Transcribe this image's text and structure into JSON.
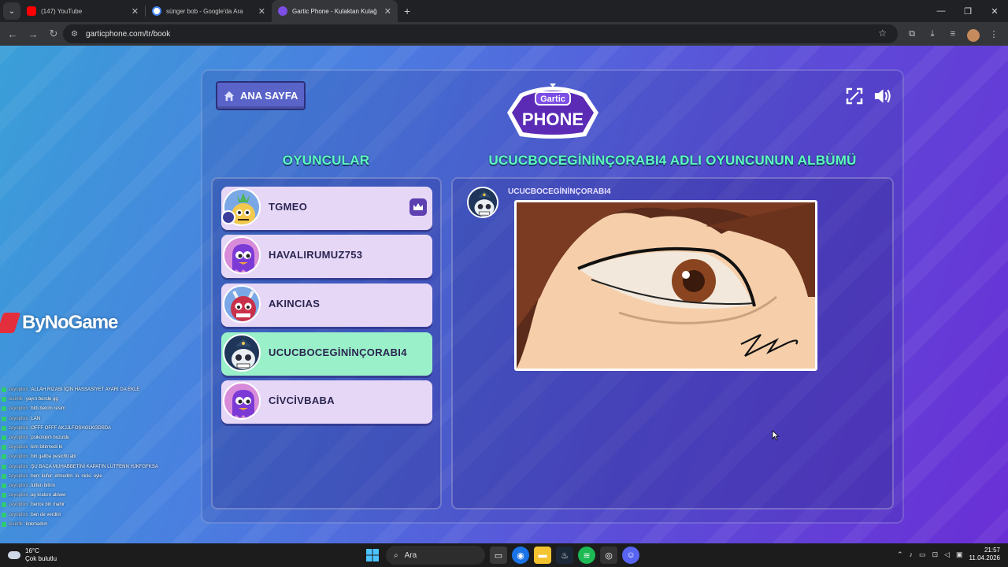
{
  "browser": {
    "tabs": [
      {
        "title": "(147) YouTube",
        "color": "#ff0000"
      },
      {
        "title": "sünger bob - Google'da Ara",
        "color": "#4285f4"
      },
      {
        "title": "Gartic Phone - Kulaktan Kulağ",
        "color": "#7c4ee4"
      }
    ],
    "url": "garticphone.com/tr/book",
    "new_tab": "+",
    "icons": [
      "back-icon",
      "forward-icon",
      "reload-icon",
      "star-icon",
      "extensions-icon",
      "download-icon",
      "media-icon",
      "profile-icon",
      "more-icon"
    ]
  },
  "overlay": {
    "brand": "ByNoGame",
    "chat": [
      {
        "user": "zeyoplixx",
        "text": "ALLAH RIZASI İÇİN HASSASİYET AYARI DA EKLE"
      },
      {
        "user": "lesinllk",
        "text": "yayın bende gg"
      },
      {
        "user": "zeyoplixx",
        "text": "bitti benim resim"
      },
      {
        "user": "zeyoplixx",
        "text": "LAN"
      },
      {
        "user": "zeyoplixx",
        "text": "OFFF OFFF AKJJLFOŞHGLKGDSDA"
      },
      {
        "user": "zeyoplixx",
        "text": "psikolojim bozuldu"
      },
      {
        "user": "zeyoplixx",
        "text": "kim bitirmedi ki"
      },
      {
        "user": "zeyoplixx",
        "text": "biri galiba pesichti abi"
      },
      {
        "user": "zeyoplixx",
        "text": "ŞU BACA MUHABBETİNİ KAPATIN LÜTFENN HJKFGFKSA"
      },
      {
        "user": "zeyoplixx",
        "text": "ben: kufur: etmedim. ki. nicki. oyle"
      },
      {
        "user": "zeyoplixx",
        "text": "lutfen bitirin"
      },
      {
        "user": "zeyoplixx",
        "text": "ay kralsın abiww"
      },
      {
        "user": "zeyoplixx",
        "text": "bence biri mahir"
      },
      {
        "user": "zeyoplixx",
        "text": "ben de verdim"
      },
      {
        "user": "lesinllk",
        "text": "kokmadım"
      }
    ]
  },
  "game": {
    "home_label": "ANA SAYFA",
    "logo_top": "Gartic",
    "logo_bottom": "PHONE",
    "players_title": "OYUNCULAR",
    "album_title": "UCUCBOCEGİNİNÇORABI4 ADLI OYUNCUNUN ALBÜMÜ",
    "players": [
      {
        "name": "TGMEO",
        "host": true
      },
      {
        "name": "HAVALIRUMUZ753",
        "host": false
      },
      {
        "name": "AKINCIAS",
        "host": false
      },
      {
        "name": "UCUCBOCEGİNİNÇORABI4",
        "host": false,
        "selected": true
      },
      {
        "name": "CİVCİVBABA",
        "host": false
      }
    ],
    "album_author": "UCUCBOCEGİNİNÇORABI4",
    "colors": {
      "accent": "#5dfbc0",
      "player_bg": "#e7d7f7",
      "active_bg": "#9af0c9"
    }
  },
  "taskbar": {
    "weather_temp": "16°C",
    "weather_desc": "Çok bulutlu",
    "search_placeholder": "Ara",
    "time": "21:57",
    "date": "11.04.2026"
  }
}
